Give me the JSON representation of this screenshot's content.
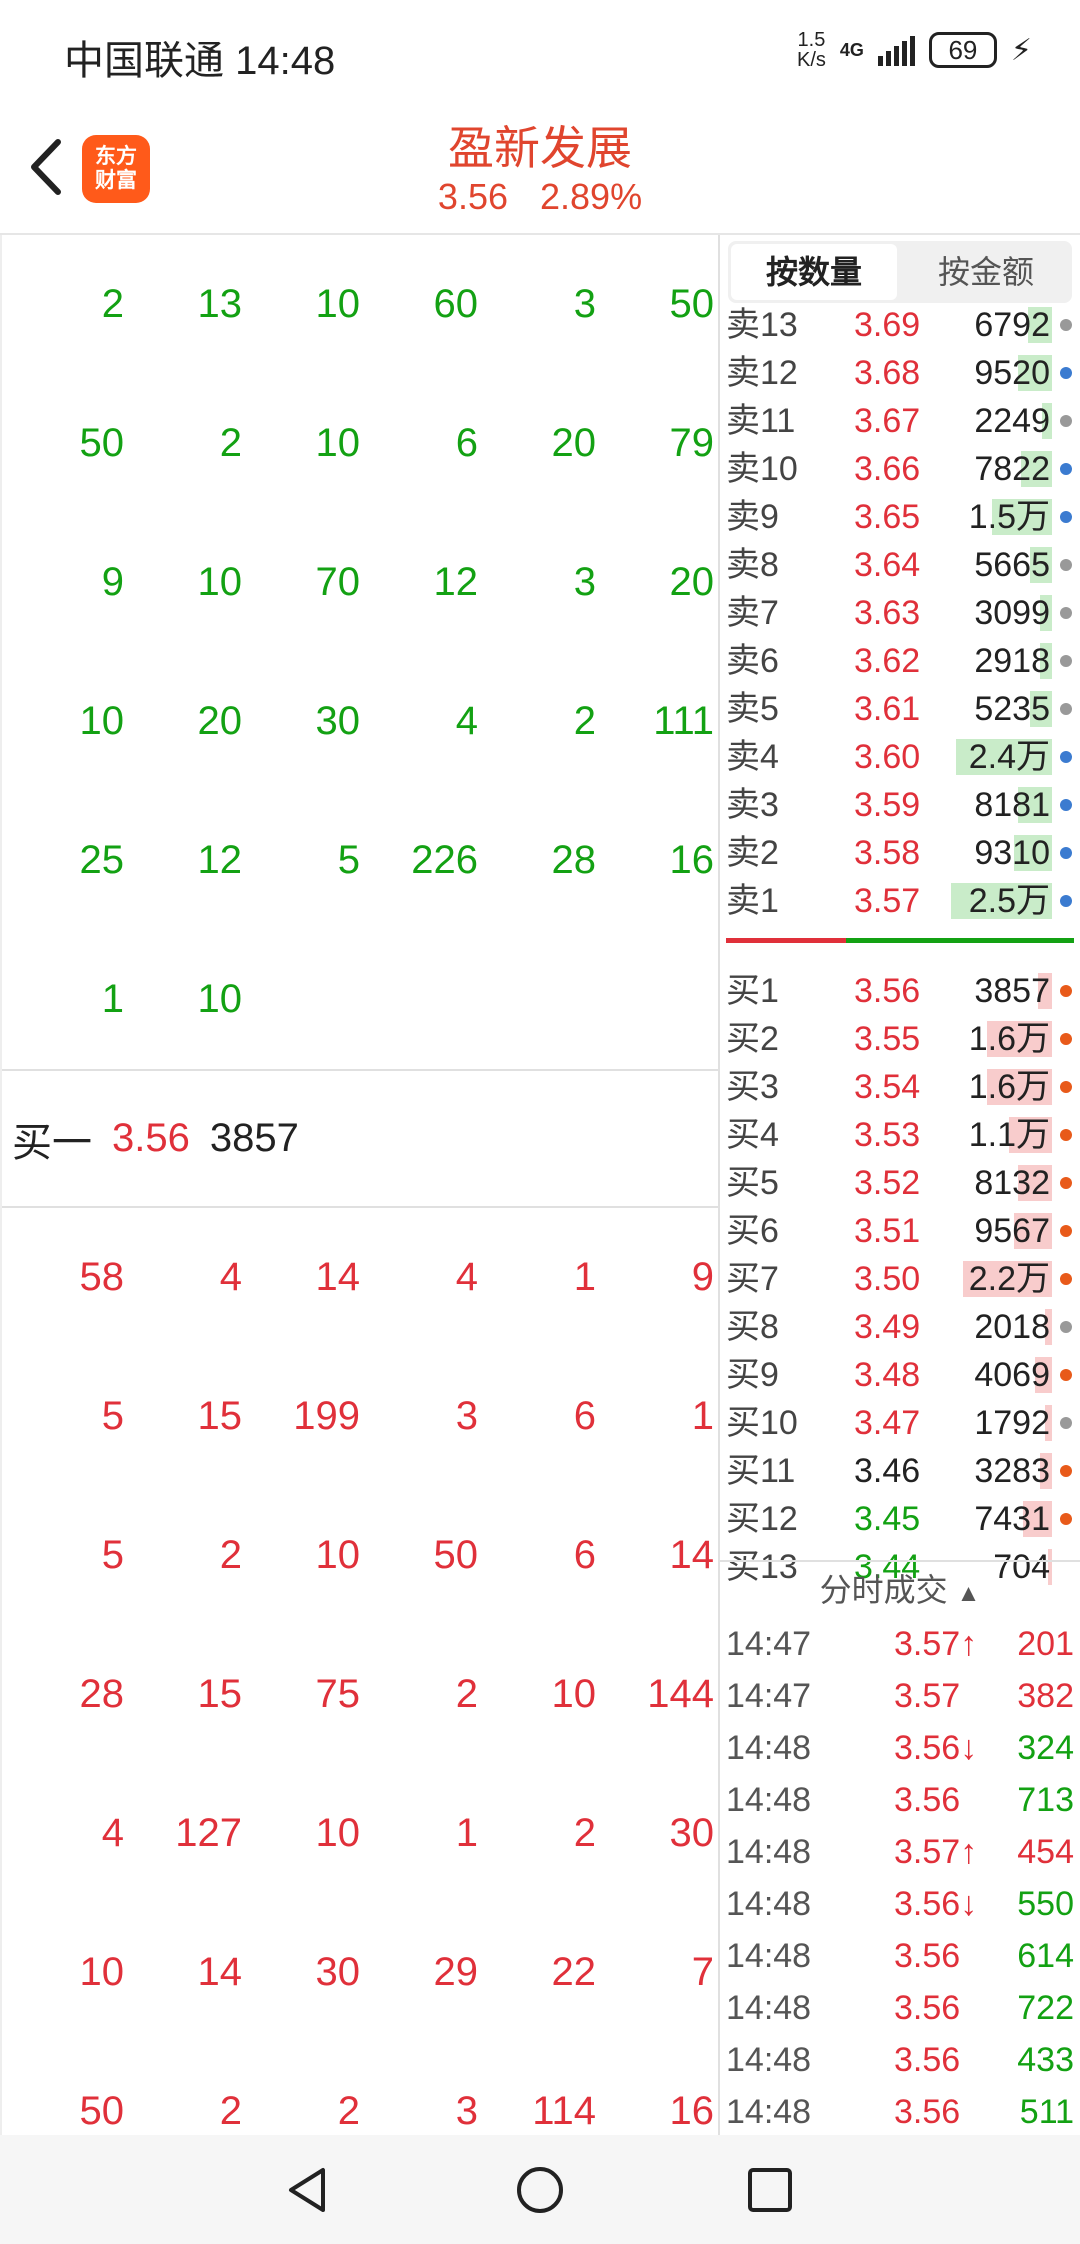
{
  "status": {
    "carrier_time": "中国联通 14:48",
    "netspeed_top": "1.5",
    "netspeed_bottom": "K/s",
    "network": "4G",
    "battery": "69"
  },
  "header": {
    "logo_line1": "东方",
    "logo_line2": "财富",
    "title": "盈新发展",
    "price": "3.56",
    "change_pct": "2.89%"
  },
  "left_panel": {
    "sell_rows": [
      [
        "2",
        "13",
        "10",
        "60",
        "3",
        "50"
      ],
      [
        "50",
        "2",
        "10",
        "6",
        "20",
        "79"
      ],
      [
        "9",
        "10",
        "70",
        "12",
        "3",
        "20"
      ],
      [
        "10",
        "20",
        "30",
        "4",
        "2",
        "111"
      ],
      [
        "25",
        "12",
        "5",
        "226",
        "28",
        "16"
      ],
      [
        "1",
        "10",
        "",
        "",
        "",
        ""
      ]
    ],
    "buy_one": {
      "label": "买一",
      "price": "3.56",
      "volume": "3857"
    },
    "buy_rows": [
      [
        "58",
        "4",
        "14",
        "4",
        "1",
        "9"
      ],
      [
        "5",
        "15",
        "199",
        "3",
        "6",
        "1"
      ],
      [
        "5",
        "2",
        "10",
        "50",
        "6",
        "14"
      ],
      [
        "28",
        "15",
        "75",
        "2",
        "10",
        "144"
      ],
      [
        "4",
        "127",
        "10",
        "1",
        "2",
        "30"
      ],
      [
        "10",
        "14",
        "30",
        "29",
        "22",
        "7"
      ],
      [
        "50",
        "2",
        "2",
        "3",
        "114",
        "16"
      ]
    ]
  },
  "tabs": {
    "by_volume": "按数量",
    "by_amount": "按金额"
  },
  "sell_book": [
    {
      "label": "卖13",
      "price": "3.69",
      "vol": "6792",
      "fill": 0.1,
      "dot": "grey"
    },
    {
      "label": "卖12",
      "price": "3.68",
      "vol": "9520",
      "fill": 0.14,
      "dot": "blue"
    },
    {
      "label": "卖11",
      "price": "3.67",
      "vol": "2249",
      "fill": 0.04,
      "dot": "grey"
    },
    {
      "label": "卖10",
      "price": "3.66",
      "vol": "7822",
      "fill": 0.13,
      "dot": "blue"
    },
    {
      "label": "卖9",
      "price": "3.65",
      "vol": "1.5万",
      "fill": 0.25,
      "dot": "blue"
    },
    {
      "label": "卖8",
      "price": "3.64",
      "vol": "5665",
      "fill": 0.09,
      "dot": "grey"
    },
    {
      "label": "卖7",
      "price": "3.63",
      "vol": "3099",
      "fill": 0.05,
      "dot": "grey"
    },
    {
      "label": "卖6",
      "price": "3.62",
      "vol": "2918",
      "fill": 0.05,
      "dot": "grey"
    },
    {
      "label": "卖5",
      "price": "3.61",
      "vol": "5235",
      "fill": 0.09,
      "dot": "grey"
    },
    {
      "label": "卖4",
      "price": "3.60",
      "vol": "2.4万",
      "fill": 0.4,
      "dot": "blue"
    },
    {
      "label": "卖3",
      "price": "3.59",
      "vol": "8181",
      "fill": 0.14,
      "dot": "blue"
    },
    {
      "label": "卖2",
      "price": "3.58",
      "vol": "9310",
      "fill": 0.16,
      "dot": "blue"
    },
    {
      "label": "卖1",
      "price": "3.57",
      "vol": "2.5万",
      "fill": 0.42,
      "dot": "blue"
    }
  ],
  "buy_book": [
    {
      "label": "买1",
      "price": "3.56",
      "vol": "3857",
      "fill": 0.06,
      "dot": "orange",
      "pcolor": "red"
    },
    {
      "label": "买2",
      "price": "3.55",
      "vol": "1.6万",
      "fill": 0.27,
      "dot": "orange",
      "pcolor": "red"
    },
    {
      "label": "买3",
      "price": "3.54",
      "vol": "1.6万",
      "fill": 0.27,
      "dot": "orange",
      "pcolor": "red"
    },
    {
      "label": "买4",
      "price": "3.53",
      "vol": "1.1万",
      "fill": 0.18,
      "dot": "orange",
      "pcolor": "red"
    },
    {
      "label": "买5",
      "price": "3.52",
      "vol": "8132",
      "fill": 0.14,
      "dot": "orange",
      "pcolor": "red"
    },
    {
      "label": "买6",
      "price": "3.51",
      "vol": "9567",
      "fill": 0.16,
      "dot": "orange",
      "pcolor": "red"
    },
    {
      "label": "买7",
      "price": "3.50",
      "vol": "2.2万",
      "fill": 0.37,
      "dot": "orange",
      "pcolor": "red"
    },
    {
      "label": "买8",
      "price": "3.49",
      "vol": "2018",
      "fill": 0.03,
      "dot": "grey",
      "pcolor": "red"
    },
    {
      "label": "买9",
      "price": "3.48",
      "vol": "4069",
      "fill": 0.07,
      "dot": "orange",
      "pcolor": "red"
    },
    {
      "label": "买10",
      "price": "3.47",
      "vol": "1792",
      "fill": 0.03,
      "dot": "grey",
      "pcolor": "red"
    },
    {
      "label": "买11",
      "price": "3.46",
      "vol": "3283",
      "fill": 0.05,
      "dot": "orange",
      "pcolor": "black"
    },
    {
      "label": "买12",
      "price": "3.45",
      "vol": "7431",
      "fill": 0.12,
      "dot": "orange",
      "pcolor": "green"
    },
    {
      "label": "买13",
      "price": "3.44",
      "vol": "704",
      "fill": 0.01,
      "dot": "none",
      "pcolor": "green"
    }
  ],
  "ticks_header": "分时成交",
  "ticks": [
    {
      "time": "14:47",
      "price": "3.57",
      "arrow": "↑",
      "vol": "201",
      "pcolor": "red",
      "vcolor": "red"
    },
    {
      "time": "14:47",
      "price": "3.57",
      "arrow": "",
      "vol": "382",
      "pcolor": "red",
      "vcolor": "red"
    },
    {
      "time": "14:48",
      "price": "3.56",
      "arrow": "↓",
      "vol": "324",
      "pcolor": "red",
      "vcolor": "green"
    },
    {
      "time": "14:48",
      "price": "3.56",
      "arrow": "",
      "vol": "713",
      "pcolor": "red",
      "vcolor": "green"
    },
    {
      "time": "14:48",
      "price": "3.57",
      "arrow": "↑",
      "vol": "454",
      "pcolor": "red",
      "vcolor": "red"
    },
    {
      "time": "14:48",
      "price": "3.56",
      "arrow": "↓",
      "vol": "550",
      "pcolor": "red",
      "vcolor": "green"
    },
    {
      "time": "14:48",
      "price": "3.56",
      "arrow": "",
      "vol": "614",
      "pcolor": "red",
      "vcolor": "green"
    },
    {
      "time": "14:48",
      "price": "3.56",
      "arrow": "",
      "vol": "722",
      "pcolor": "red",
      "vcolor": "green"
    },
    {
      "time": "14:48",
      "price": "3.56",
      "arrow": "",
      "vol": "433",
      "pcolor": "red",
      "vcolor": "green"
    },
    {
      "time": "14:48",
      "price": "3.56",
      "arrow": "",
      "vol": "511",
      "pcolor": "red",
      "vcolor": "green"
    }
  ],
  "colors": {
    "up": "#e0303a",
    "down": "#13a113",
    "brand": "#ff5a1a"
  }
}
